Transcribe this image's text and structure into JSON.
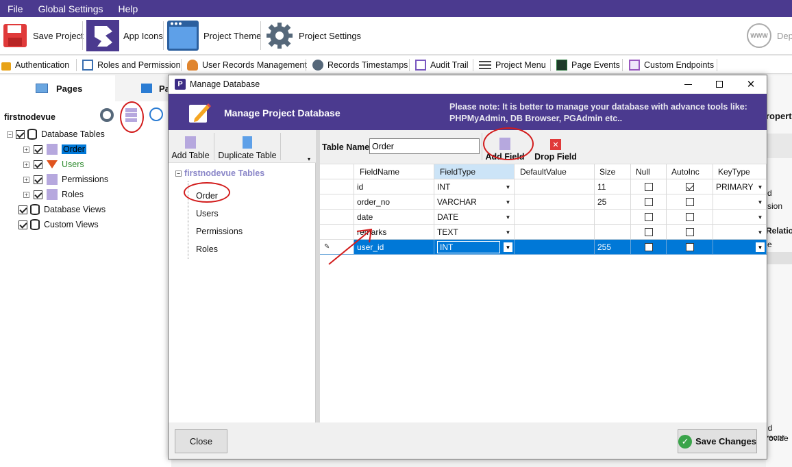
{
  "menubar": {
    "items": [
      "File",
      "Global Settings",
      "Help"
    ]
  },
  "toolbar1": {
    "save_project": "Save Project",
    "app_icons": "App Icons",
    "project_theme": "Project Theme",
    "project_settings": "Project Settings",
    "deploy_partial": "Dep"
  },
  "toolbar2": {
    "authentication": "Authentication",
    "roles": "Roles and Permission",
    "user_records": "User Records Management",
    "timestamps": "Records Timestamps",
    "audit": "Audit Trail",
    "project_menu": "Project Menu",
    "page_events": "Page Events",
    "custom_endpoints": "Custom Endpoints"
  },
  "leftpanel": {
    "tab_pages": "Pages",
    "tab_second_partial": "Pa",
    "project_name": "firstnodevue",
    "tree": {
      "database_tables": "Database Tables",
      "order": "Order",
      "users": "Users",
      "permissions": "Permissions",
      "roles": "Roles",
      "database_views": "Database Views",
      "custom_views": "Custom Views"
    }
  },
  "rightbg": {
    "propert": "ropert",
    "d": "d",
    "sion": "sion",
    "relatio": "Relatio",
    "e": "e",
    "ld_recor": "ld recor",
    "rovide": "rovide"
  },
  "dialog": {
    "title": "Manage Database",
    "logo_letter": "P",
    "banner_title": "Manage Project Database",
    "banner_note": "Please note: It is better to manage your database with advance tools like: PHPMyAdmin, DB Browser, PGAdmin etc..",
    "add_table": "Add Table",
    "duplicate_table": "Duplicate Table",
    "tree_root": "firstnodevue Tables",
    "tables": [
      "Order",
      "Users",
      "Permissions",
      "Roles"
    ],
    "table_name_label": "Table Name",
    "table_name_value": "Order",
    "add_field": "Add Field",
    "drop_field": "Drop Field",
    "columns": [
      "FieldName",
      "FieldType",
      "DefaultValue",
      "Size",
      "Null",
      "AutoInc",
      "KeyType"
    ],
    "rows": [
      {
        "name": "id",
        "type": "INT",
        "default": "",
        "size": "11",
        "null": false,
        "autoinc": true,
        "key": "PRIMARY"
      },
      {
        "name": "order_no",
        "type": "VARCHAR",
        "default": "",
        "size": "25",
        "null": false,
        "autoinc": false,
        "key": ""
      },
      {
        "name": "date",
        "type": "DATE",
        "default": "",
        "size": "",
        "null": false,
        "autoinc": false,
        "key": ""
      },
      {
        "name": "remarks",
        "type": "TEXT",
        "default": "",
        "size": "",
        "null": false,
        "autoinc": false,
        "key": ""
      },
      {
        "name": "user_id",
        "type": "INT",
        "default": "",
        "size": "255",
        "null": false,
        "autoinc": false,
        "key": ""
      }
    ],
    "close_label": "Close",
    "save_label": "Save Changes"
  },
  "colors": {
    "brand_purple": "#4b3a8f",
    "selection_blue": "#0078d7",
    "annotation_red": "#d21c1c"
  }
}
